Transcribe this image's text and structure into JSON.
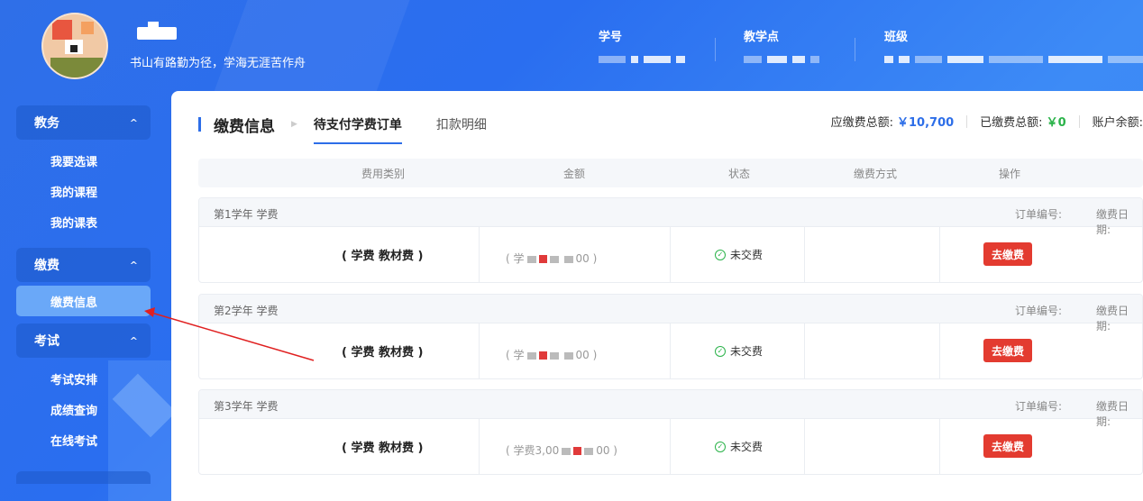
{
  "header": {
    "motto": "书山有路勤为径，学海无涯苦作舟",
    "student_id_label": "学号",
    "teaching_point_label": "教学点",
    "class_label": "班级"
  },
  "sidebar": {
    "groups": [
      {
        "label": "教务",
        "items": [
          "我要选课",
          "我的课程",
          "我的课表"
        ]
      },
      {
        "label": "缴费",
        "items": [
          "缴费信息"
        ],
        "active_item": "缴费信息"
      },
      {
        "label": "考试",
        "items": [
          "考试安排",
          "成绩查询",
          "在线考试"
        ]
      }
    ]
  },
  "main": {
    "title": "缴费信息",
    "tabs": [
      {
        "label": "待支付学费订单",
        "active": true
      },
      {
        "label": "扣款明细",
        "active": false
      }
    ],
    "totals": {
      "due_label": "应缴费总额:",
      "due_value": "￥10,700",
      "paid_label": "已缴费总额:",
      "paid_value": "￥0",
      "balance_label": "账户余额:"
    },
    "table": {
      "columns": [
        "费用类别",
        "金额",
        "状态",
        "缴费方式",
        "操作"
      ]
    },
    "orders": [
      {
        "year": "第1学年 学费",
        "order_no_label": "订单编号:",
        "pay_date_label": "缴费日期:",
        "fee_type": "( 学费 教材费 )",
        "amount_open": "( 学",
        "amount_close": "00 )",
        "status": "未交费",
        "action": "去缴费"
      },
      {
        "year": "第2学年 学费",
        "order_no_label": "订单编号:",
        "pay_date_label": "缴费日期:",
        "fee_type": "( 学费 教材费 )",
        "amount_open": "( 学",
        "amount_close": "00 )",
        "status": "未交费",
        "action": "去缴费"
      },
      {
        "year": "第3学年 学费",
        "order_no_label": "订单编号:",
        "pay_date_label": "缴费日期:",
        "fee_type": "( 学费 教材费 )",
        "amount_open": "( 学费3,00",
        "amount_close": "00 )",
        "status": "未交费",
        "action": "去缴费"
      }
    ]
  },
  "colors": {
    "primary": "#2d6ee8",
    "pay_button": "#e33b30",
    "paid_green": "#2bb34a",
    "annotation_arrow": "#e02020"
  },
  "icons": {
    "status": "check-circle-icon",
    "menu_chevron": "chevron-up-icon"
  }
}
